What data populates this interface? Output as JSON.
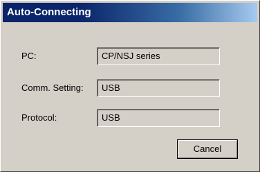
{
  "window": {
    "title": "Auto-Connecting"
  },
  "fields": [
    {
      "label": "PC:",
      "value": "CP/NSJ series"
    },
    {
      "label": "Comm. Setting:",
      "value": "USB"
    },
    {
      "label": "Protocol:",
      "value": "USB"
    }
  ],
  "buttons": {
    "cancel_label": "Cancel"
  },
  "colors": {
    "title_bar_start": "#0a246a",
    "title_bar_end": "#a6caf0",
    "dialog_background": "#d4d0c8"
  }
}
